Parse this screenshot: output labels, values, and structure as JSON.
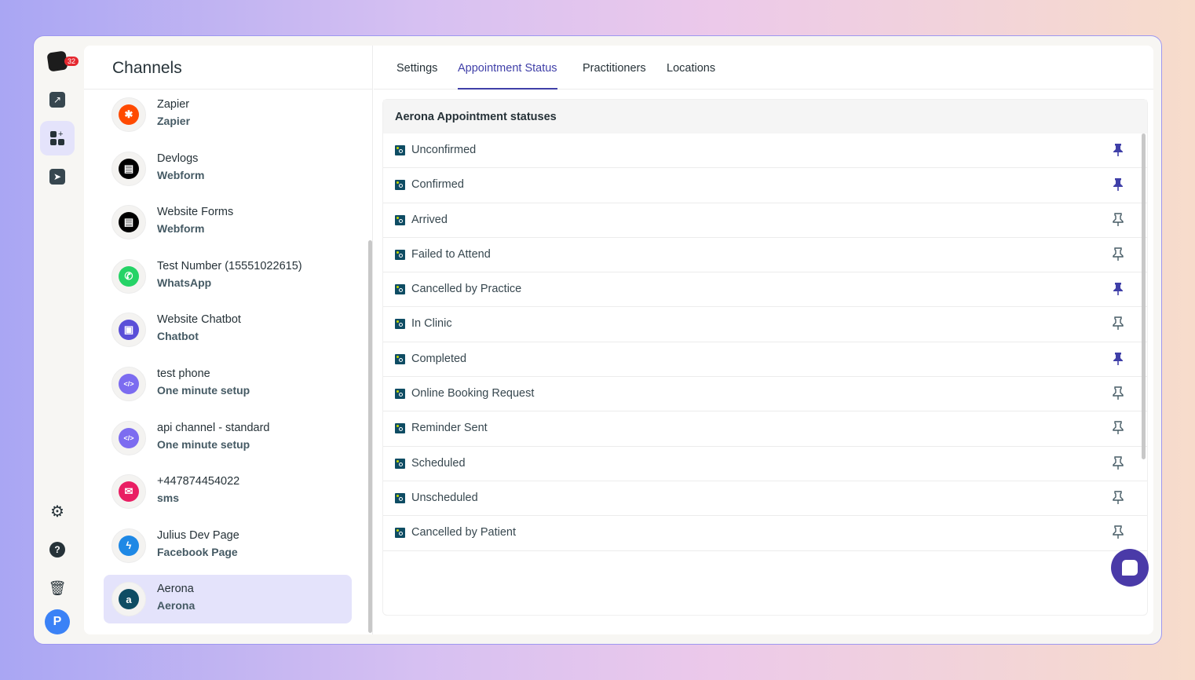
{
  "rail": {
    "badge_count": "32",
    "avatar_letter": "P"
  },
  "left": {
    "title": "Channels",
    "channels": [
      {
        "name": "Zapier",
        "sub": "Zapier",
        "icon": "zapier-icon",
        "color": "#ff4a00",
        "glyph": "✱"
      },
      {
        "name": "Devlogs",
        "sub": "Webform",
        "icon": "webform-icon",
        "color": "#000000",
        "glyph": "▤"
      },
      {
        "name": "Website Forms",
        "sub": "Webform",
        "icon": "webform-icon",
        "color": "#000000",
        "glyph": "▤"
      },
      {
        "name": "Test Number (15551022615)",
        "sub": "WhatsApp",
        "icon": "whatsapp-icon",
        "color": "#25d366",
        "glyph": "✆"
      },
      {
        "name": "Website Chatbot",
        "sub": "Chatbot",
        "icon": "chatbot-icon",
        "color": "#5a4fd8",
        "glyph": "▣"
      },
      {
        "name": "test phone",
        "sub": "One minute setup",
        "icon": "code-icon",
        "color": "#7c6cf0",
        "glyph": "</>"
      },
      {
        "name": "api channel - standard",
        "sub": "One minute setup",
        "icon": "code-icon",
        "color": "#7c6cf0",
        "glyph": "</>"
      },
      {
        "name": "+447874454022",
        "sub": "sms",
        "icon": "sms-icon",
        "color": "#e91e63",
        "glyph": "✉"
      },
      {
        "name": "Julius Dev Page",
        "sub": "Facebook Page",
        "icon": "messenger-icon",
        "color": "#1e88e5",
        "glyph": "ϟ"
      },
      {
        "name": "Aerona",
        "sub": "Aerona",
        "icon": "aerona-icon",
        "color": "#0e4c63",
        "glyph": "a"
      }
    ]
  },
  "tabs": [
    "Settings",
    "Appointment Status",
    "Practitioners",
    "Locations"
  ],
  "active_tab": "Appointment Status",
  "statuses": {
    "heading": "Aerona Appointment statuses",
    "items": [
      {
        "label": "Unconfirmed",
        "pinned": true
      },
      {
        "label": "Confirmed",
        "pinned": true
      },
      {
        "label": "Arrived",
        "pinned": false
      },
      {
        "label": "Failed to Attend",
        "pinned": false
      },
      {
        "label": "Cancelled by Practice",
        "pinned": true
      },
      {
        "label": "In Clinic",
        "pinned": false
      },
      {
        "label": "Completed",
        "pinned": true
      },
      {
        "label": "Online Booking Request",
        "pinned": false
      },
      {
        "label": "Reminder Sent",
        "pinned": false
      },
      {
        "label": "Scheduled",
        "pinned": false
      },
      {
        "label": "Unscheduled",
        "pinned": false
      },
      {
        "label": "Cancelled by Patient",
        "pinned": false
      }
    ]
  },
  "colors": {
    "accent": "#3f3fa8",
    "pinned": "#3f3fa8",
    "unpinned": "#455a64"
  }
}
